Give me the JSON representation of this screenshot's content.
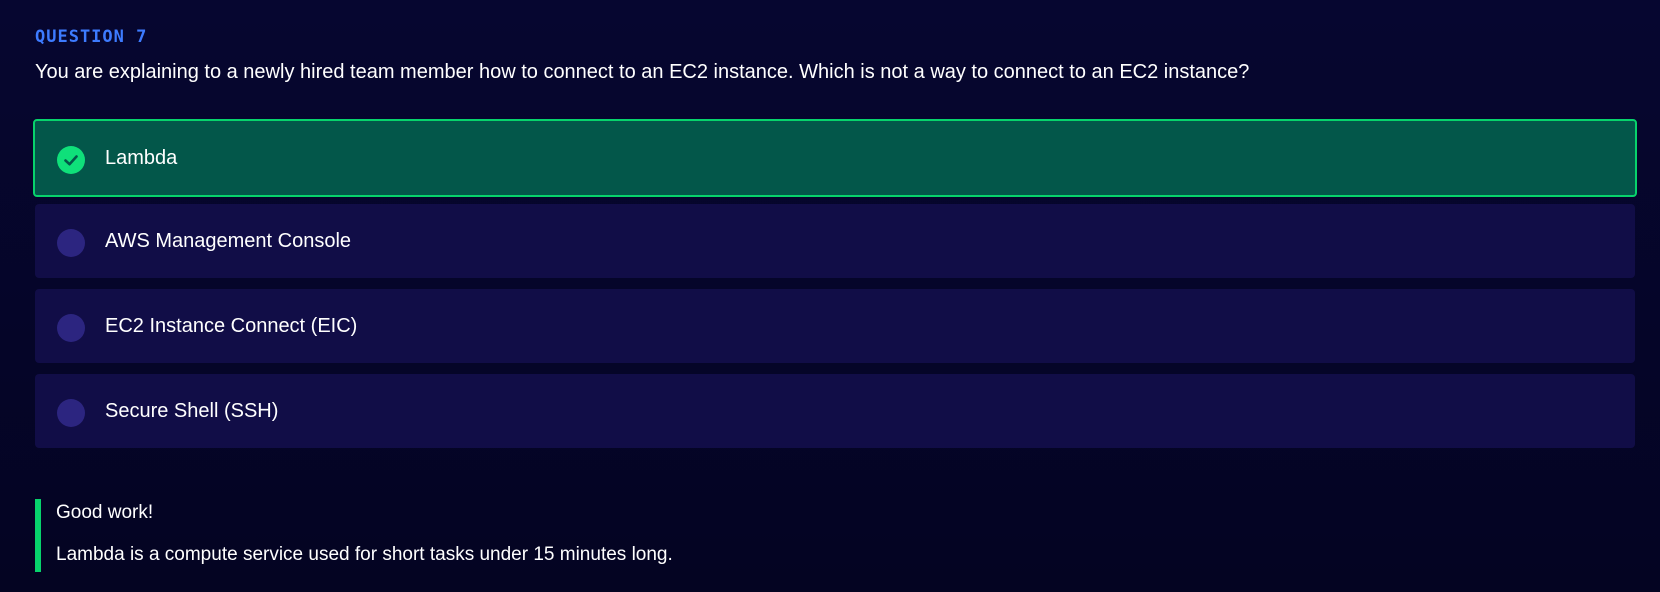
{
  "question": {
    "label": "QUESTION 7",
    "text": "You are explaining to a newly hired team member how to connect to an EC2 instance. Which is not a way to connect to an EC2 instance?"
  },
  "options": [
    {
      "label": "Lambda",
      "selected": true,
      "correct": true,
      "icon": "check-icon"
    },
    {
      "label": "AWS Management Console",
      "selected": false
    },
    {
      "label": "EC2 Instance Connect (EIC)",
      "selected": false
    },
    {
      "label": "Secure Shell (SSH)",
      "selected": false
    }
  ],
  "feedback": {
    "title": "Good work!",
    "explanation": "Lambda is a compute service used for short tasks under 15 minutes long."
  },
  "colors": {
    "accent": "#3d7bff",
    "correct": "#07d36c",
    "selected_bg": "#03574a",
    "option_bg": "#110d47",
    "page_bg": "#06062a"
  }
}
